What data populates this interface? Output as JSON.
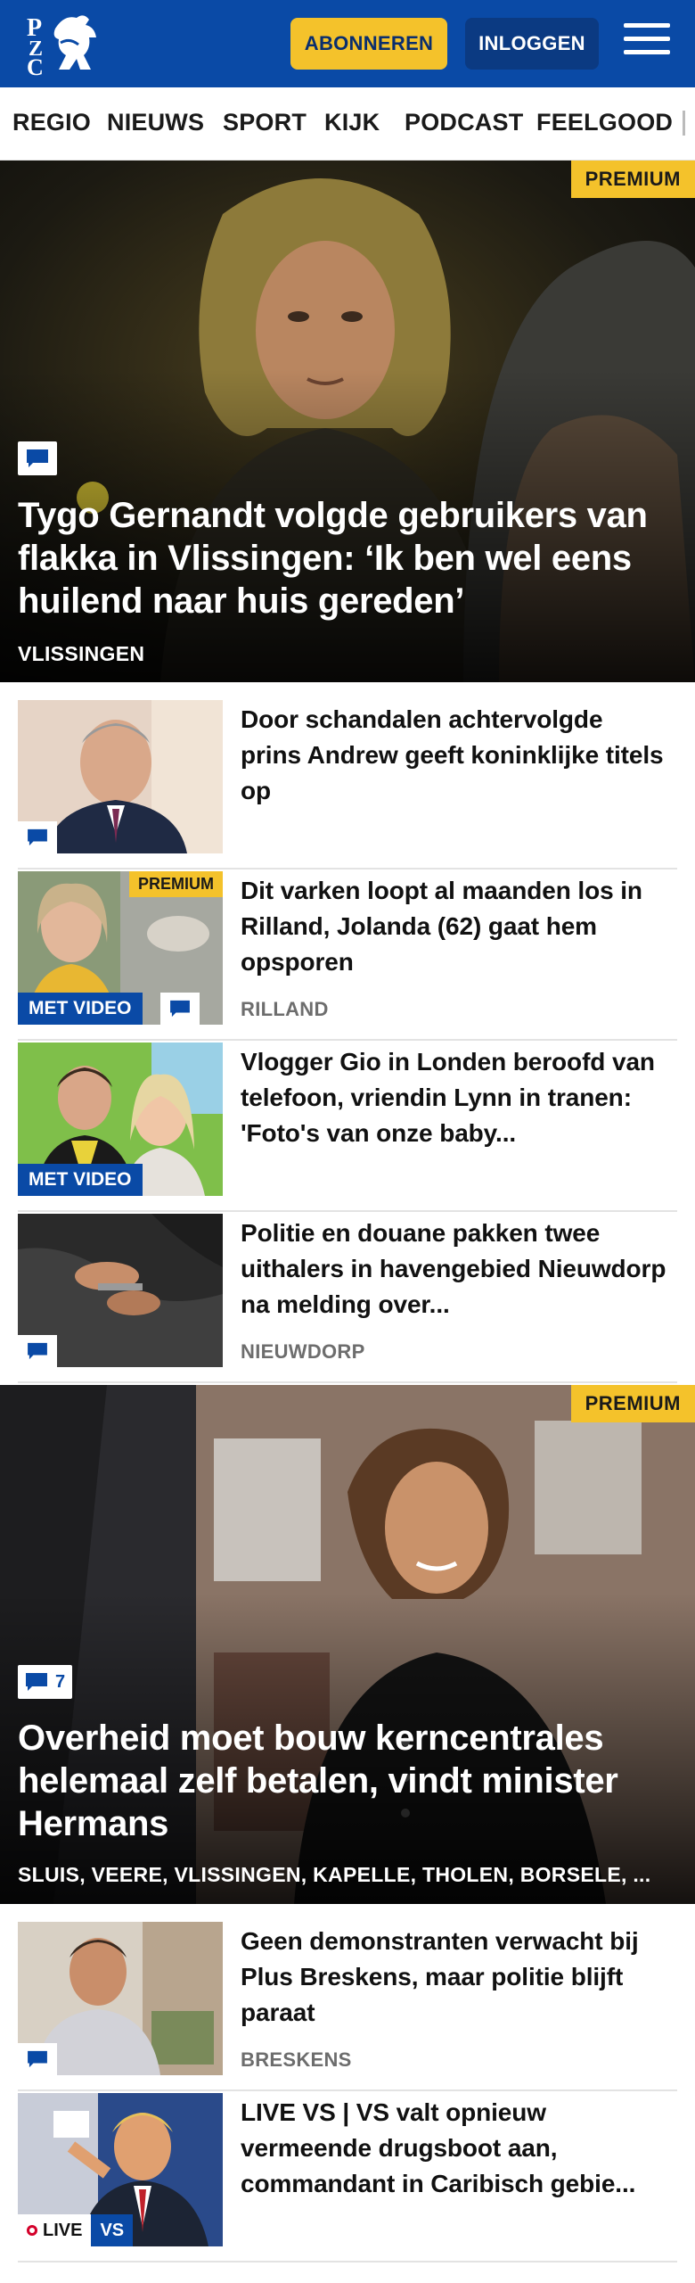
{
  "header": {
    "logo_text": "PZC",
    "subscribe_label": "ABONNEREN",
    "login_label": "INLOGGEN",
    "menu_icon": "hamburger-icon",
    "brand_color": "#0a4aa6",
    "accent_color": "#f4c22b"
  },
  "nav": {
    "items": [
      "REGIO",
      "NIEUWS",
      "SPORT",
      "KIJK",
      "PODCAST",
      "FEELGOOD"
    ]
  },
  "hero1": {
    "badge": "PREMIUM",
    "comment_icon": "comment-icon",
    "title": "Tygo Gernandt volgde gebruikers van flakka in Vlissingen: ‘Ik ben wel eens huilend naar huis gereden’",
    "location": "VLISSINGEN"
  },
  "articles": [
    {
      "title": "Door schandalen achtervolgde prins Andrew geeft koninklijke titels op",
      "location": ""
    },
    {
      "badge": "PREMIUM",
      "video_label": "MET VIDEO",
      "title": "Dit varken loopt al maanden los in Rilland, Jolanda (62) gaat hem opsporen",
      "location": "RILLAND"
    },
    {
      "video_label": "MET VIDEO",
      "title": "Vlogger Gio in Londen beroofd van telefoon, vriendin Lynn in tranen: 'Foto's van onze baby...",
      "location": ""
    },
    {
      "title": "Politie en douane pakken twee uithalers in havengebied Nieuwdorp na melding over...",
      "location": "NIEUWDORP"
    }
  ],
  "hero2": {
    "badge": "PREMIUM",
    "comment_count": "7",
    "title": "Overheid moet bouw kerncentrales helemaal zelf betalen, vindt minister Hermans",
    "location": "SLUIS, VEERE, VLISSINGEN, KAPELLE, THOLEN, BORSELE, ..."
  },
  "articles2": [
    {
      "title": "Geen demonstranten verwacht bij Plus Breskens, maar politie blijft paraat",
      "location": "BRESKENS"
    },
    {
      "live_label": "LIVE",
      "tag_label": "VS",
      "title": "LIVE VS | VS valt opnieuw vermeende drugsboot aan, commandant in Caribisch gebie...",
      "location": ""
    }
  ]
}
